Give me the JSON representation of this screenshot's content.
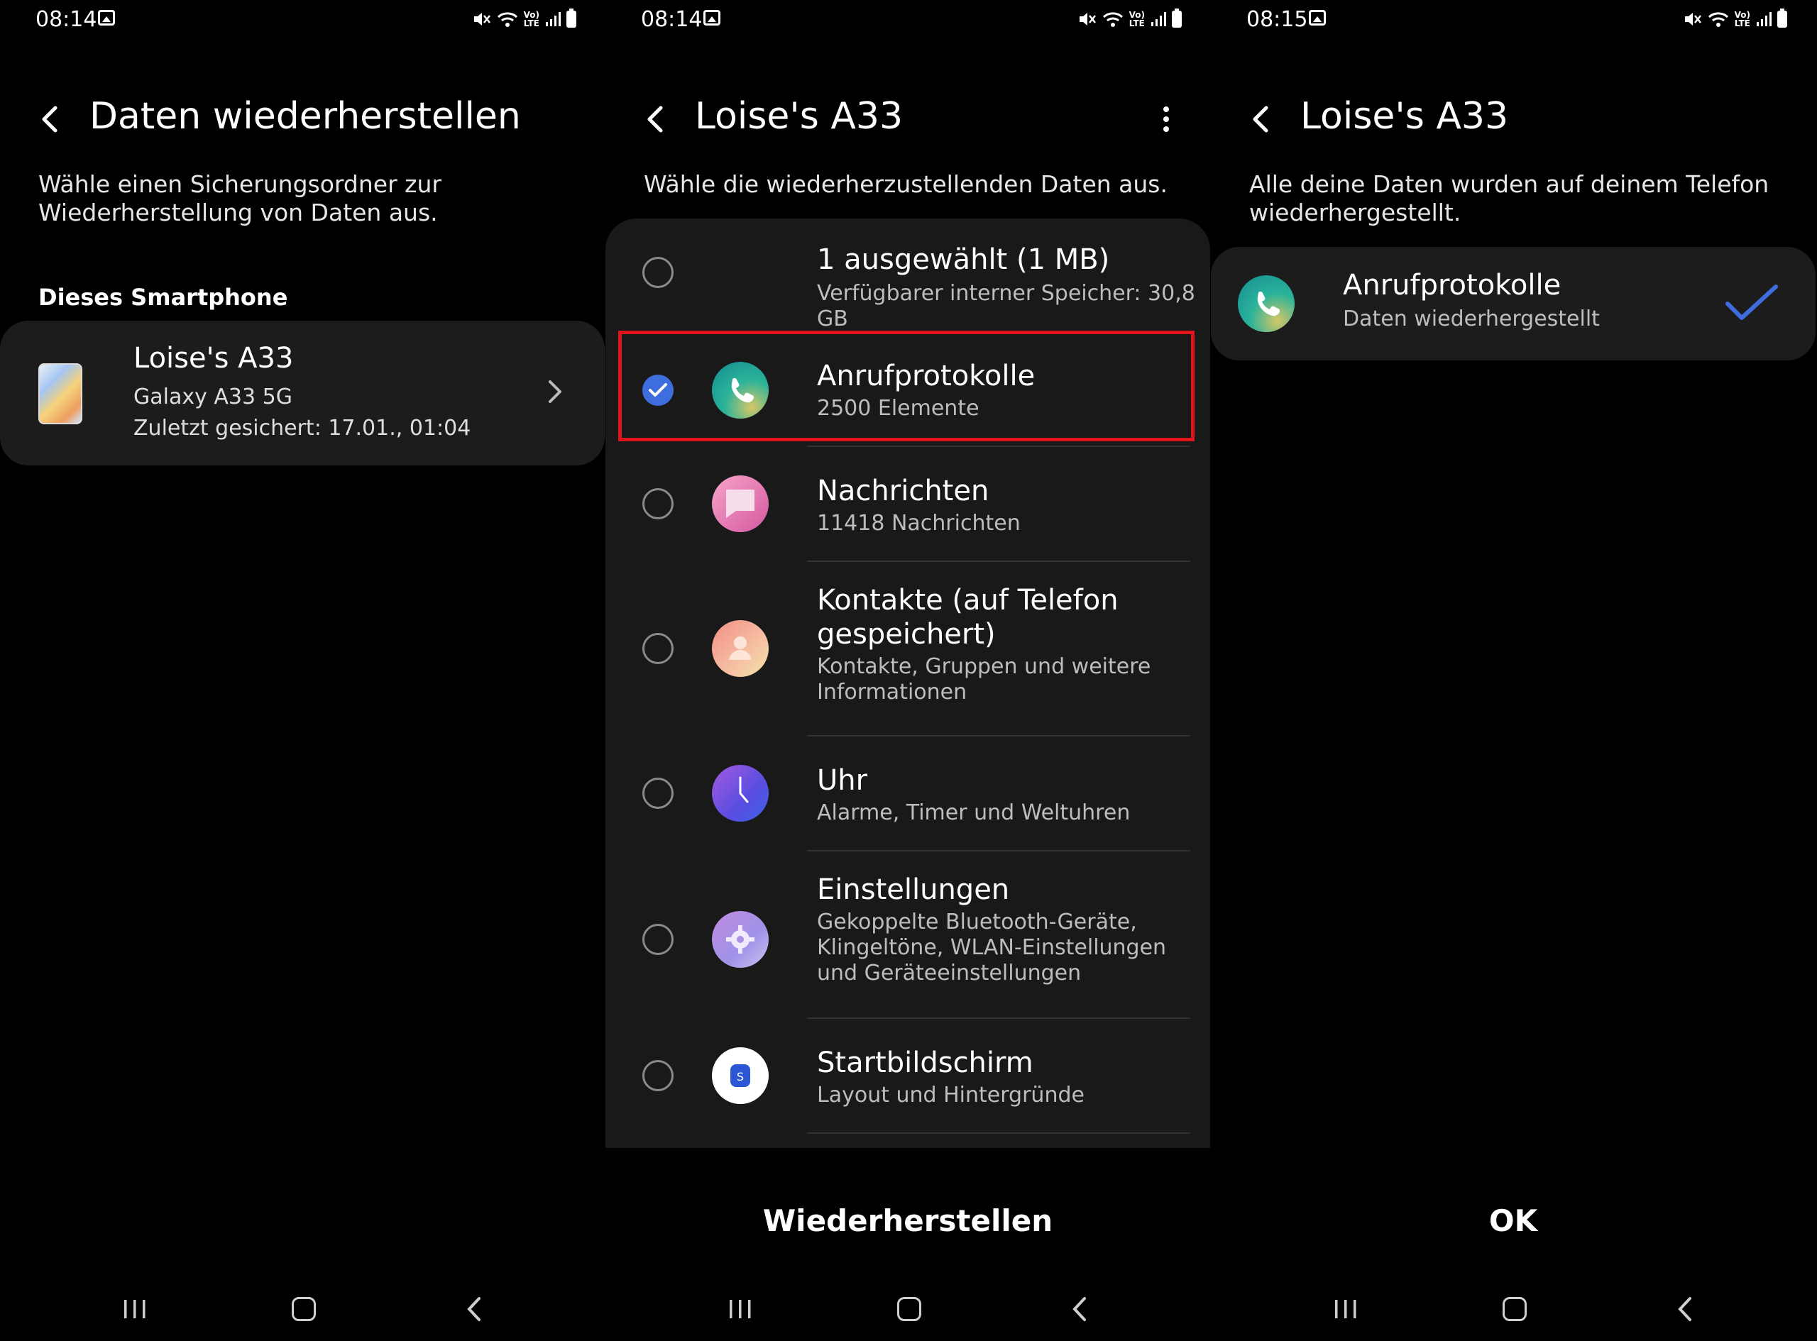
{
  "panels": [
    {
      "status": {
        "time": "08:14"
      },
      "title": "Daten wiederherstellen",
      "subtitle_line1": "Wähle einen Sicherungsordner zur",
      "subtitle_line2": "Wiederherstellung von Daten aus.",
      "section_label": "Dieses Smartphone",
      "device": {
        "name": "Loise's A33",
        "model": "Galaxy A33 5G",
        "last_backup": "Zuletzt gesichert: 17.01., 01:04"
      }
    },
    {
      "status": {
        "time": "08:14"
      },
      "title": "Loise's A33",
      "subtitle": "Wähle die wiederherzustellenden Daten aus.",
      "summary": {
        "title": "1 ausgewählt (1 MB)",
        "sub": "Verfügbarer interner Speicher: 30,8 GB"
      },
      "items": [
        {
          "title": "Anrufprotokolle",
          "sub": "2500 Elemente",
          "checked": true,
          "icon": "phone-icon"
        },
        {
          "title": "Nachrichten",
          "sub": "11418 Nachrichten",
          "checked": false,
          "icon": "messages-icon"
        },
        {
          "title_line1": "Kontakte (auf Telefon",
          "title_line2": "gespeichert)",
          "sub_line1": "Kontakte, Gruppen und weitere",
          "sub_line2": "Informationen",
          "checked": false,
          "icon": "contacts-icon"
        },
        {
          "title": "Uhr",
          "sub": "Alarme, Timer und Weltuhren",
          "checked": false,
          "icon": "clock-icon"
        },
        {
          "title": "Einstellungen",
          "sub_line1": "Gekoppelte Bluetooth-Geräte,",
          "sub_line2": "Klingeltöne, WLAN-Einstellungen",
          "sub_line3": "und Geräteeinstellungen",
          "checked": false,
          "icon": "settings-icon"
        },
        {
          "title": "Startbildschirm",
          "sub": "Layout und Hintergründe",
          "checked": false,
          "icon": "home-screen-icon"
        }
      ],
      "action": "Wiederherstellen"
    },
    {
      "status": {
        "time": "08:15"
      },
      "title": "Loise's A33",
      "subtitle_line1": "Alle deine Daten wurden auf deinem Telefon",
      "subtitle_line2": "wiederhergestellt.",
      "result": {
        "title": "Anrufprotokolle",
        "sub": "Daten wiederhergestellt"
      },
      "action": "OK"
    }
  ],
  "colors": {
    "accent": "#3e6dde",
    "highlight": "#e0141c",
    "card": "#1c1c1c"
  }
}
